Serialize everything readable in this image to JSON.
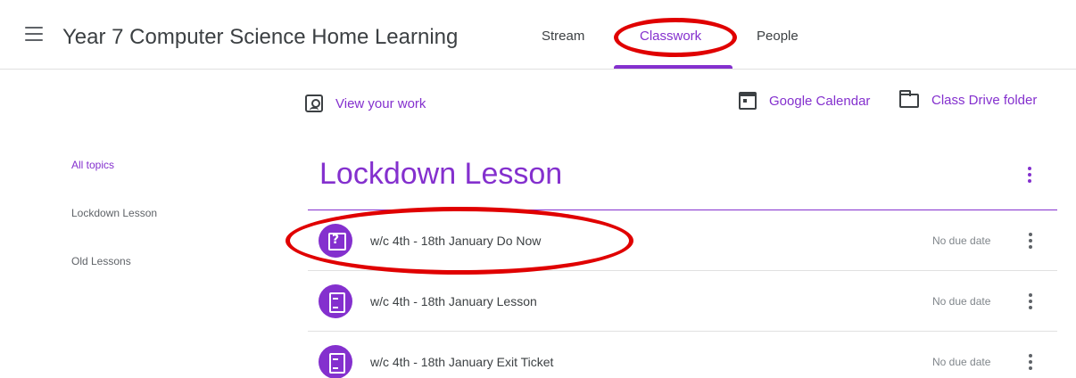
{
  "header": {
    "class_title": "Year 7 Computer Science Home Learning",
    "tabs": [
      {
        "label": "Stream"
      },
      {
        "label": "Classwork"
      },
      {
        "label": "People"
      }
    ]
  },
  "toolbar": {
    "view_work": "View your work",
    "google_calendar": "Google Calendar",
    "class_drive": "Class Drive folder"
  },
  "topics_nav": {
    "items": [
      {
        "label": "All topics"
      },
      {
        "label": "Lockdown Lesson"
      },
      {
        "label": "Old Lessons"
      }
    ]
  },
  "topic": {
    "title": "Lockdown Lesson",
    "items": [
      {
        "title": "w/c 4th - 18th January Do Now",
        "due": "No due date",
        "icon": "question-icon"
      },
      {
        "title": "w/c 4th - 18th January Lesson",
        "due": "No due date",
        "icon": "material-icon"
      },
      {
        "title": "w/c 4th - 18th January Exit Ticket",
        "due": "No due date",
        "icon": "material-icon"
      }
    ]
  },
  "colors": {
    "accent": "#8430ce",
    "annotation": "#e00000",
    "text": "#3c4043"
  }
}
